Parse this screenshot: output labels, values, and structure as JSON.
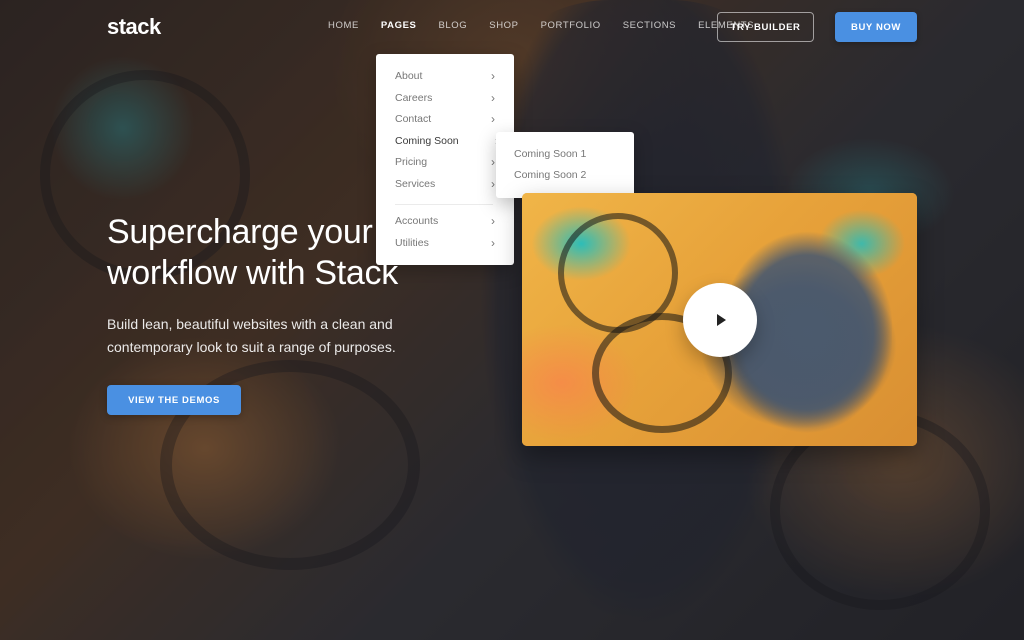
{
  "header": {
    "logo": "stack",
    "nav": [
      {
        "label": "HOME",
        "active": false
      },
      {
        "label": "PAGES",
        "active": true
      },
      {
        "label": "BLOG",
        "active": false
      },
      {
        "label": "SHOP",
        "active": false
      },
      {
        "label": "PORTFOLIO",
        "active": false
      },
      {
        "label": "SECTIONS",
        "active": false
      },
      {
        "label": "ELEMENTS",
        "active": false
      }
    ],
    "try_builder": "TRY BUILDER",
    "buy_now": "BUY NOW"
  },
  "pages_dropdown": {
    "items": [
      {
        "label": "About",
        "has_submenu": true
      },
      {
        "label": "Careers",
        "has_submenu": true
      },
      {
        "label": "Contact",
        "has_submenu": true
      },
      {
        "label": "Coming Soon",
        "has_submenu": true,
        "expanded": true
      },
      {
        "label": "Pricing",
        "has_submenu": true
      },
      {
        "label": "Services",
        "has_submenu": true
      },
      {
        "label": "Accounts",
        "has_submenu": true
      },
      {
        "label": "Utilities",
        "has_submenu": true
      }
    ],
    "chevron": "›",
    "submenu_coming_soon": [
      "Coming Soon 1",
      "Coming Soon 2"
    ]
  },
  "hero": {
    "title_line_1": "Supercharge your",
    "title_line_2": "workflow with Stack",
    "subtitle_line_1": "Build lean, beautiful websites with a clean and",
    "subtitle_line_2": "contemporary look to suit a range of purposes.",
    "cta": "VIEW THE DEMOS"
  },
  "video": {
    "play_icon": "play-icon"
  },
  "colors": {
    "accent": "#4a90e2",
    "text_light": "#ffffff",
    "menu_text": "#777777"
  }
}
